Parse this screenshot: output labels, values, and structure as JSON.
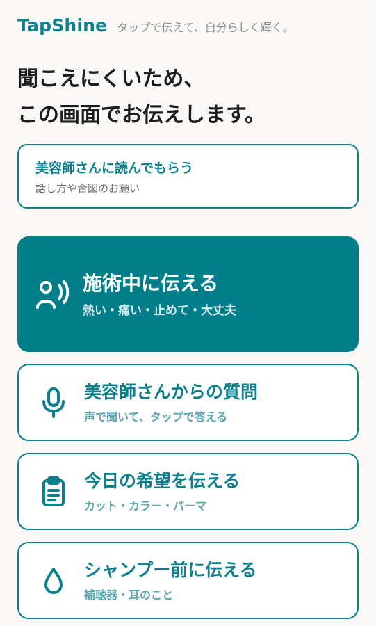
{
  "header": {
    "brand": "TapShine",
    "tagline": "タップで伝えて、自分らしく輝く。"
  },
  "headline": {
    "line1": "聞こえにくいため、",
    "line2": "この画面でお伝えします。"
  },
  "read_card": {
    "title": "美容師さんに読んでもらう",
    "subtitle": "話し方や合図のお願い"
  },
  "menu": [
    {
      "title": "施術中に伝える",
      "subtitle": "熱い・痛い・止めて・大丈夫",
      "icon": "person-speaking-icon"
    },
    {
      "title": "美容師さんからの質問",
      "subtitle": "声で聞いて、タップで答える",
      "icon": "microphone-icon"
    },
    {
      "title": "今日の希望を伝える",
      "subtitle": "カット・カラー・パーマ",
      "icon": "clipboard-icon"
    },
    {
      "title": "シャンプー前に伝える",
      "subtitle": "補聴器・耳のこと",
      "icon": "water-drop-icon"
    }
  ],
  "colors": {
    "accent": "#0b7f8c",
    "primary_card": "#007f8b",
    "background": "#f9f8f6",
    "subtitle_muted": "#5ba6ae"
  }
}
